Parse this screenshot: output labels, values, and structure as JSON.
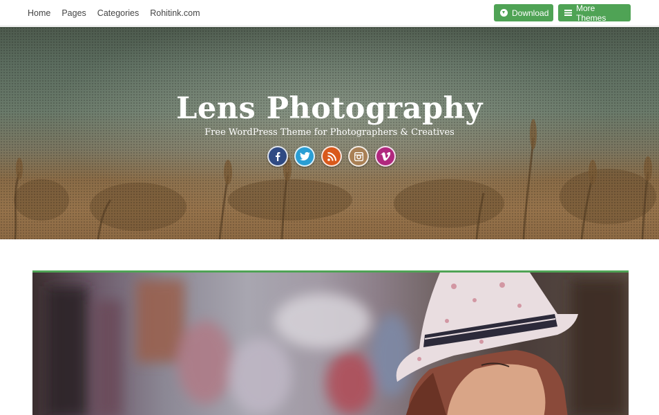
{
  "nav": {
    "items": [
      "Home",
      "Pages",
      "Categories",
      "Rohitink.com"
    ]
  },
  "actions": {
    "download_label": "Download",
    "more_themes_label": "More Themes",
    "accent_color": "#4fa355"
  },
  "hero": {
    "title": "Lens Photography",
    "subtitle": "Free WordPress Theme for Photographers & Creatives",
    "socials": [
      {
        "icon": "facebook-icon",
        "glyph": "f",
        "color": "#2f4a83"
      },
      {
        "icon": "twitter-icon",
        "glyph": "t",
        "color": "#2a9ed4"
      },
      {
        "icon": "rss-icon",
        "glyph": "rss",
        "color": "#d9591b"
      },
      {
        "icon": "instagram-icon",
        "glyph": "cam",
        "color": "#a98055"
      },
      {
        "icon": "vimeo-icon",
        "glyph": "v",
        "color": "#b0287e"
      }
    ]
  }
}
